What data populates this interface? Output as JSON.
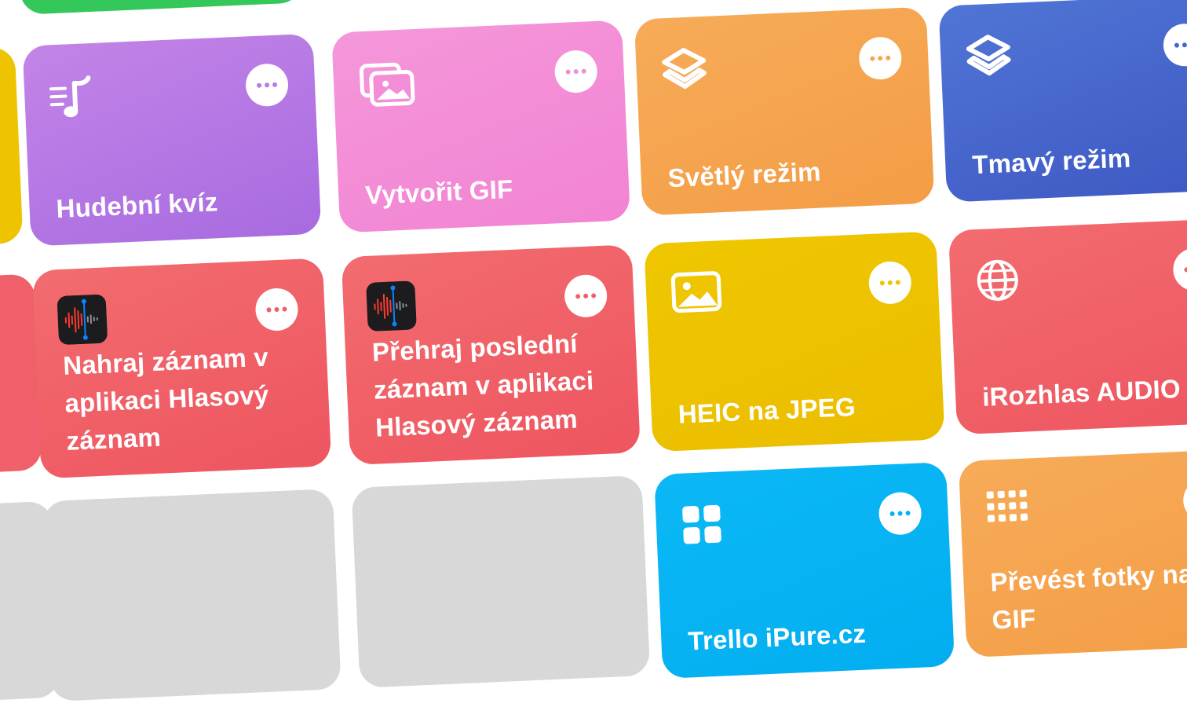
{
  "colors": {
    "purple": "#b57be6",
    "pink": "#f38dd6",
    "orange": "#f6a74f",
    "navy": "#4a66cd",
    "red": "#f0606a",
    "yellow": "#eec400",
    "blue": "#07b3f3",
    "green": "#34c759",
    "empty": "#d8d8d8"
  },
  "shortcuts": [
    {
      "label": "Hudební kvíz",
      "icon": "music-list-icon",
      "color": "purple"
    },
    {
      "label": "Vytvořit GIF",
      "icon": "photos-icon",
      "color": "pink"
    },
    {
      "label": "Světlý režim",
      "icon": "layers-icon",
      "color": "orange"
    },
    {
      "label": "Tmavý režim",
      "icon": "layers-icon",
      "color": "navy"
    },
    {
      "label": "Nahraj záznam v aplikaci Hlasový záznam",
      "icon": "voice-memos-icon",
      "color": "red"
    },
    {
      "label": "Přehraj poslední záznam v aplikaci Hlasový záznam",
      "icon": "voice-memos-icon",
      "color": "red"
    },
    {
      "label": "HEIC na JPEG",
      "icon": "photo-icon",
      "color": "yellow"
    },
    {
      "label": "iRozhlas AUDIO",
      "icon": "globe-icon",
      "color": "red"
    },
    {
      "label": "Trello iPure.cz",
      "icon": "apps-grid-icon",
      "color": "blue"
    },
    {
      "label": "Převést fotky na GIF",
      "icon": "dots-grid-icon",
      "color": "orange"
    }
  ],
  "more_button_icon": "ellipsis-icon"
}
